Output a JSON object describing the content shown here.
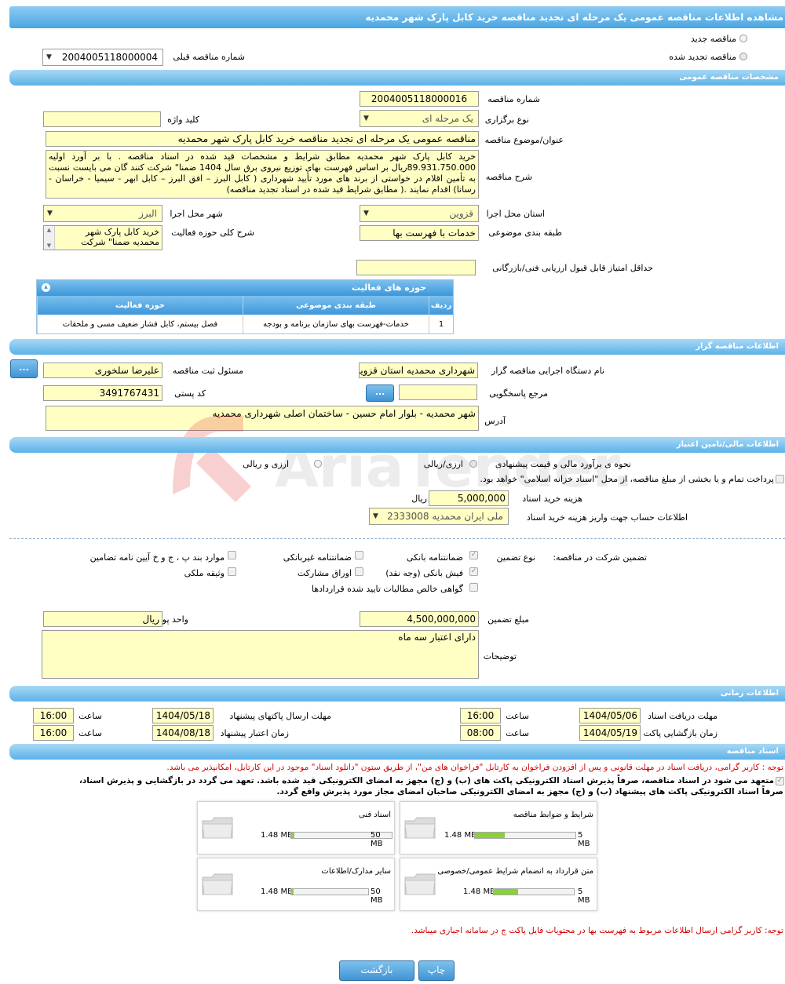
{
  "page_title": "مشاهده اطلاعات مناقصه عمومی یک مرحله ای تجدید مناقصه خرید کابل پارک شهر محمدیه",
  "tender_type": {
    "option_new": "مناقصه جدید",
    "option_renewed": "مناقصه تجدید شده",
    "previous_number_label": "شماره مناقصه قبلی",
    "previous_number": "2004005118000004"
  },
  "general": {
    "header": "مشخصات مناقصه عمومی",
    "number_label": "شماره مناقصه",
    "number": "2004005118000016",
    "holding_type_label": "نوع برگزاری",
    "holding_type": "یک مرحله ای",
    "keyword_label": "کلید واژه",
    "keyword": "",
    "subject_label": "عنوان/موضوع مناقصه",
    "subject": "مناقصه عمومی یک مرحله ای  تجدید مناقصه خرید کابل پارک شهر محمدیه",
    "description_label": "شرح مناقصه",
    "description": "خرید کابل پارک شهر محمدیه مطابق شرایط و مشخصات قید شده در  اسناد مناقصه  . با بر آورد اولیه 89.931.750.000ریال بر اساس فهرست بهای توزیع نیروی برق سال 1404 ضمنا\"  شرکت کنند گان می بایست نسبت به تأمین اقلام در خواستی از برند های مورد تأیید شهرداری ( کابل البرز – افق البرز – کابل ابهر - سیمیا - خراسان - رسانا) اقدام نمایند  .( مطابق شرایط قید شده در اسناد تجدید  مناقصه)",
    "province_label": "استان محل اجرا",
    "province": "قزوین",
    "city_label": "شهر محل اجرا",
    "city": "البرز",
    "category_label": "طبقه بندی موضوعی",
    "category": "خدمات با فهرست بها",
    "activity_desc_label": "شرح کلی حوزه فعالیت",
    "activity_desc": "خرید کابل پارک شهر محمدیه ضمنا\"  شرکت",
    "min_score_label": "حداقل امتیاز قابل قبول ارزیابی فنی/بازرگانی",
    "min_score": ""
  },
  "activities": {
    "header": "حوزه های فعالیت",
    "columns": [
      "ردیف",
      "طبقه بندی موضوعی",
      "حوزه فعالیت"
    ],
    "rows": [
      [
        "1",
        "خدمات-فهرست بهای سازمان برنامه و بودجه",
        "فصل بیستم، کابل فشار ضعیف مسی و ملحقات"
      ]
    ]
  },
  "organizer": {
    "header": "اطلاعات مناقصه گزار",
    "agency_label": "نام دستگاه اجرایی مناقصه گزار",
    "agency": "شهرداری محمدیه استان قزوین",
    "registrar_label": "مسئول ثبت مناقصه",
    "registrar": "علیرضا سلخوری",
    "reference_label": "مرجع پاسخگویی",
    "reference": "",
    "postal_label": "کد پستی",
    "postal": "3491767431",
    "address_label": "آدرس",
    "address": "شهر محمدیه - بلوار امام حسین - ساختمان اصلی شهرداری محمدیه",
    "more_btn": "...",
    "lookup_btn": "..."
  },
  "finance": {
    "header": "اطلاعات مالی/تامین اعتبار",
    "estimate_label": "نحوه ی برآورد مالی و قیمت پیشنهادی",
    "estimate_opt1": "ارزی/ریالی",
    "estimate_opt2": "ارزی و ریالی",
    "treasury_text": "پرداخت تمام و یا بخشی از مبلغ مناقصه، از محل \"اسناد خزانه اسلامی\" خواهد بود.",
    "doc_fee_label": "هزینه خرید اسناد",
    "doc_fee": "5,000,000",
    "doc_fee_unit": "ریال",
    "account_label": "اطلاعات حساب جهت واریز هزینه خرید اسناد",
    "account": "ملی ایران محمدیه 2333008"
  },
  "guarantee": {
    "label": "تضمین شرکت در مناقصه:",
    "type_label": "نوع تضمین",
    "options": {
      "bank_guarantee": "ضمانتنامه بانکی",
      "nonbank_guarantee": "ضمانتنامه غیربانکی",
      "bylaw": "موارد بند پ ، ج و خ آیین نامه تضامین",
      "bank_receipt": "فیش بانکی (وجه نقد)",
      "bonds": "اوراق مشارکت",
      "property": "وثیقه ملکی",
      "net_claims": "گواهی خالص مطالبات تایید شده قراردادها"
    },
    "amount_label": "مبلغ تضمین",
    "amount": "4,500,000,000",
    "currency_label": "واحد پول",
    "currency": "ریال",
    "notes_label": "توضیحات",
    "notes": "دارای اعتبار سه ماه"
  },
  "timing": {
    "header": "اطلاعات زمانی",
    "receive_deadline_label": "مهلت دریافت اسناد",
    "receive_deadline_date": "1404/05/06",
    "receive_deadline_time": "16:00",
    "send_deadline_label": "مهلت ارسال پاکتهای پیشنهاد",
    "send_deadline_date": "1404/05/18",
    "send_deadline_time": "16:00",
    "opening_label": "زمان بازگشایی پاکت ها",
    "opening_date": "1404/05/19",
    "opening_time": "08:00",
    "validity_label": "زمان اعتبار پیشنهاد",
    "validity_date": "1404/08/18",
    "validity_time": "16:00",
    "time_label": "ساعت"
  },
  "documents": {
    "header": "اسناد مناقصه",
    "note1": "توجه : کاربر گرامی، دریافت اسناد در مهلت قانونی و پس از افزودن فراخوان به کارتابل \"فراخوان های من\"، از طریق ستون \"دانلود اسناد\" موجود در این کارتابل، امکانپذیر می باشد.",
    "commit1": "متعهد می شود در اسناد مناقصه، صرفاً پذیرش اسناد الکترونیکی پاکت های (ب) و (ج) مجهز به امضای الکترونیکی قید شده باشد. تعهد می گردد در بازگشایی و پذیرش اسناد،",
    "commit2": "صرفاً اسناد الکترونیکی پاکت های پیشنهاد (ب) و (ج) مجهز به امضای الکترونیکی صاحبان امضای مجاز مورد پذیرش واقع گردد.",
    "files": [
      {
        "title": "شرایط و ضوابط مناقصه",
        "used": "1.48 MB",
        "max": "5 MB",
        "fill": 0.3
      },
      {
        "title": "اسناد فنی",
        "used": "1.48 MB",
        "max": "50 MB",
        "fill": 0.03
      },
      {
        "title": "متن قرارداد به انضمام شرایط عمومی/خصوصی",
        "used": "1.48 MB",
        "max": "5 MB",
        "fill": 0.3
      },
      {
        "title": "سایر مدارک/اطلاعات",
        "used": "1.48 MB",
        "max": "50 MB",
        "fill": 0.03
      }
    ],
    "note2": "توجه: کاربر گرامی ارسال اطلاعات مربوط به فهرست بها در محتویات فایل پاکت ج در سامانه اجباری میباشد."
  },
  "actions": {
    "print": "چاپ",
    "back": "بازگشت"
  },
  "watermark": "AriaTender.neT"
}
